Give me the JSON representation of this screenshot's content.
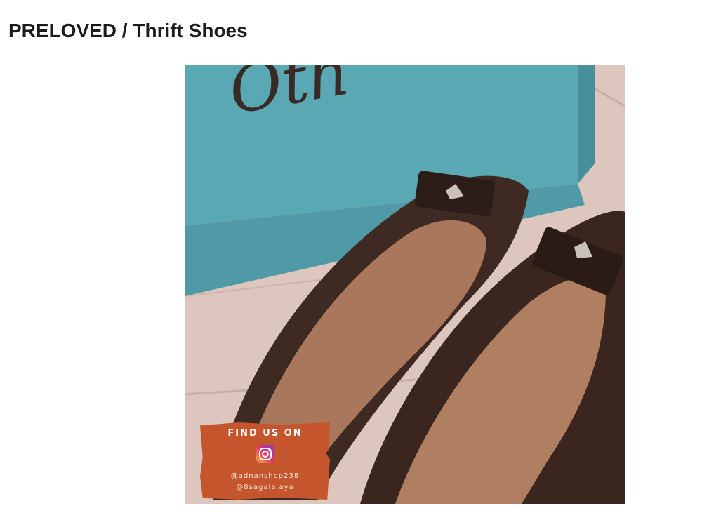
{
  "page": {
    "title": "PRELOVED / Thrift Shoes"
  },
  "photo": {
    "box_brand_text": "Oth",
    "subject": "pair of dark brown leather ballet flats in front of a turquoise shoe box",
    "colors": {
      "box": "#5aa7b2",
      "shoe": "#3e2a22",
      "insole": "#a9785c",
      "floor": "#d8c2ba",
      "promo": "#c4552c"
    }
  },
  "promo": {
    "heading": "FIND US ON",
    "icon": "instagram-icon",
    "handles": [
      "@adnanshop238",
      "@8sagala.aya"
    ]
  }
}
